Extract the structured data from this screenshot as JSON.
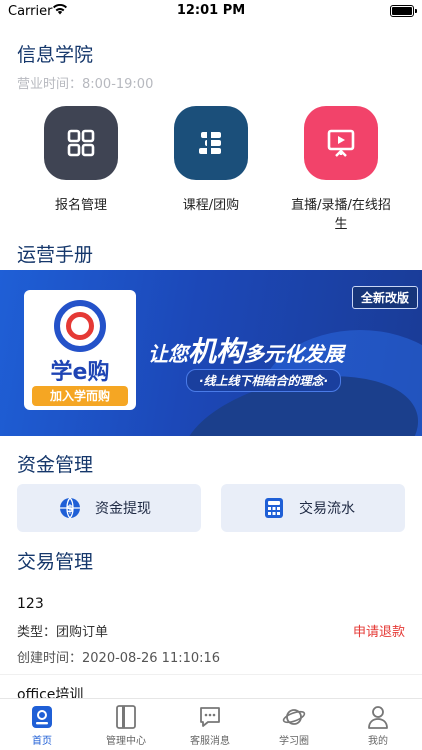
{
  "status_bar": {
    "carrier": "Carrier",
    "time": "12:01 PM"
  },
  "header": {
    "title": "信息学院",
    "hours": "营业时间：8:00-19:00"
  },
  "quick_actions": [
    {
      "label": "报名管理",
      "icon": "grid-icon",
      "color": "#3f4453"
    },
    {
      "label": "课程/团购",
      "icon": "course-icon",
      "color": "#1b4f7a"
    },
    {
      "label": "直播/录播/在线招生",
      "icon": "presentation-icon",
      "color": "#f2436a"
    }
  ],
  "manual": {
    "title": "运营手册",
    "banner": {
      "badge": "全新改版",
      "logo_text": "学e购",
      "logo_tag": "加入学而购",
      "slogan_prefix": "让您",
      "slogan_strong": "机构",
      "slogan_suffix": "多元化发展",
      "slogan_sub": "·线上线下相结合的理念·"
    }
  },
  "funds": {
    "title": "资金管理",
    "buttons": [
      {
        "label": "资金提现",
        "icon": "dollar-globe-icon"
      },
      {
        "label": "交易流水",
        "icon": "calculator-icon"
      }
    ]
  },
  "transactions": {
    "title": "交易管理",
    "items": [
      {
        "name": "123",
        "type": "类型：团购订单",
        "status": "申请退款",
        "created": "创建时间：2020-08-26 11:10:16"
      },
      {
        "name": "office培训"
      }
    ]
  },
  "tabbar": [
    {
      "label": "首页",
      "icon": "home-icon",
      "active": true
    },
    {
      "label": "管理中心",
      "icon": "book-icon",
      "active": false
    },
    {
      "label": "客服消息",
      "icon": "chat-icon",
      "active": false
    },
    {
      "label": "学习圈",
      "icon": "planet-icon",
      "active": false
    },
    {
      "label": "我的",
      "icon": "user-icon",
      "active": false
    }
  ],
  "colors": {
    "primary": "#1f5fd6",
    "title": "#15376b",
    "danger": "#e53935"
  }
}
